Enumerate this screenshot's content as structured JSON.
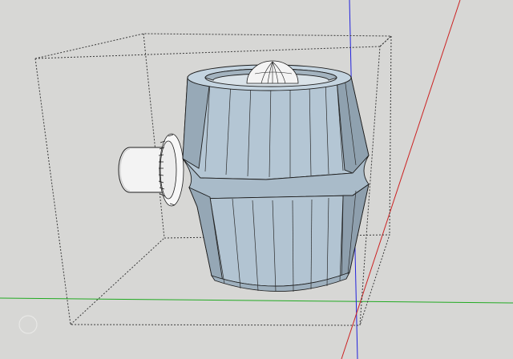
{
  "viewport": {
    "background": "#d7d7d5",
    "axis_colors": {
      "red": "#cc2222",
      "green": "#22aa22",
      "blue": "#2222dd"
    }
  },
  "model": {
    "fill_light": "#b9cbd9",
    "fill_mid": "#a7b9c7",
    "fill_dark": "#8d9fad",
    "edge": "#1e1e1e"
  }
}
